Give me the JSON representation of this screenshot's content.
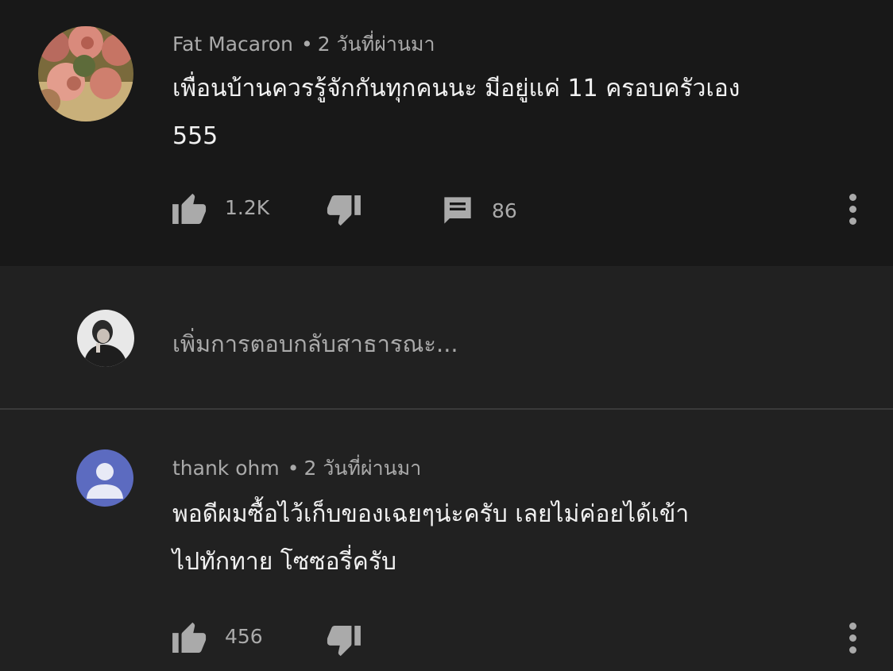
{
  "comments": [
    {
      "author": "Fat Macaron",
      "time": "2 วันที่ผ่านมา",
      "text_line1": "เพื่อนบ้านควรรู้จักกันทุกคนนะ มีอยู่แค่ 11 ครอบครัวเอง",
      "text_line2": "555",
      "likes": "1.2K",
      "replies": "86"
    },
    {
      "author": "thank ohm",
      "time": "2 วันที่ผ่านมา",
      "text_line1": "พอดีผมซื้อไว้เก็บของเฉยๆน่ะครับ เลยไม่ค่อยได้เข้า",
      "text_line2": "ไปทักทาย โซซอรี่ครับ",
      "likes": "456"
    }
  ],
  "reply": {
    "placeholder": "เพิ่มการตอบกลับสาธารณะ..."
  },
  "icons": {
    "like": "thumb-up-icon",
    "dislike": "thumb-down-icon",
    "replies": "comment-icon",
    "more": "more-vertical-icon"
  },
  "colors": {
    "background": "#212121",
    "comment_bg": "#181818",
    "secondary_text": "#aaaaaa",
    "avatar_default": "#5c6bc0"
  }
}
